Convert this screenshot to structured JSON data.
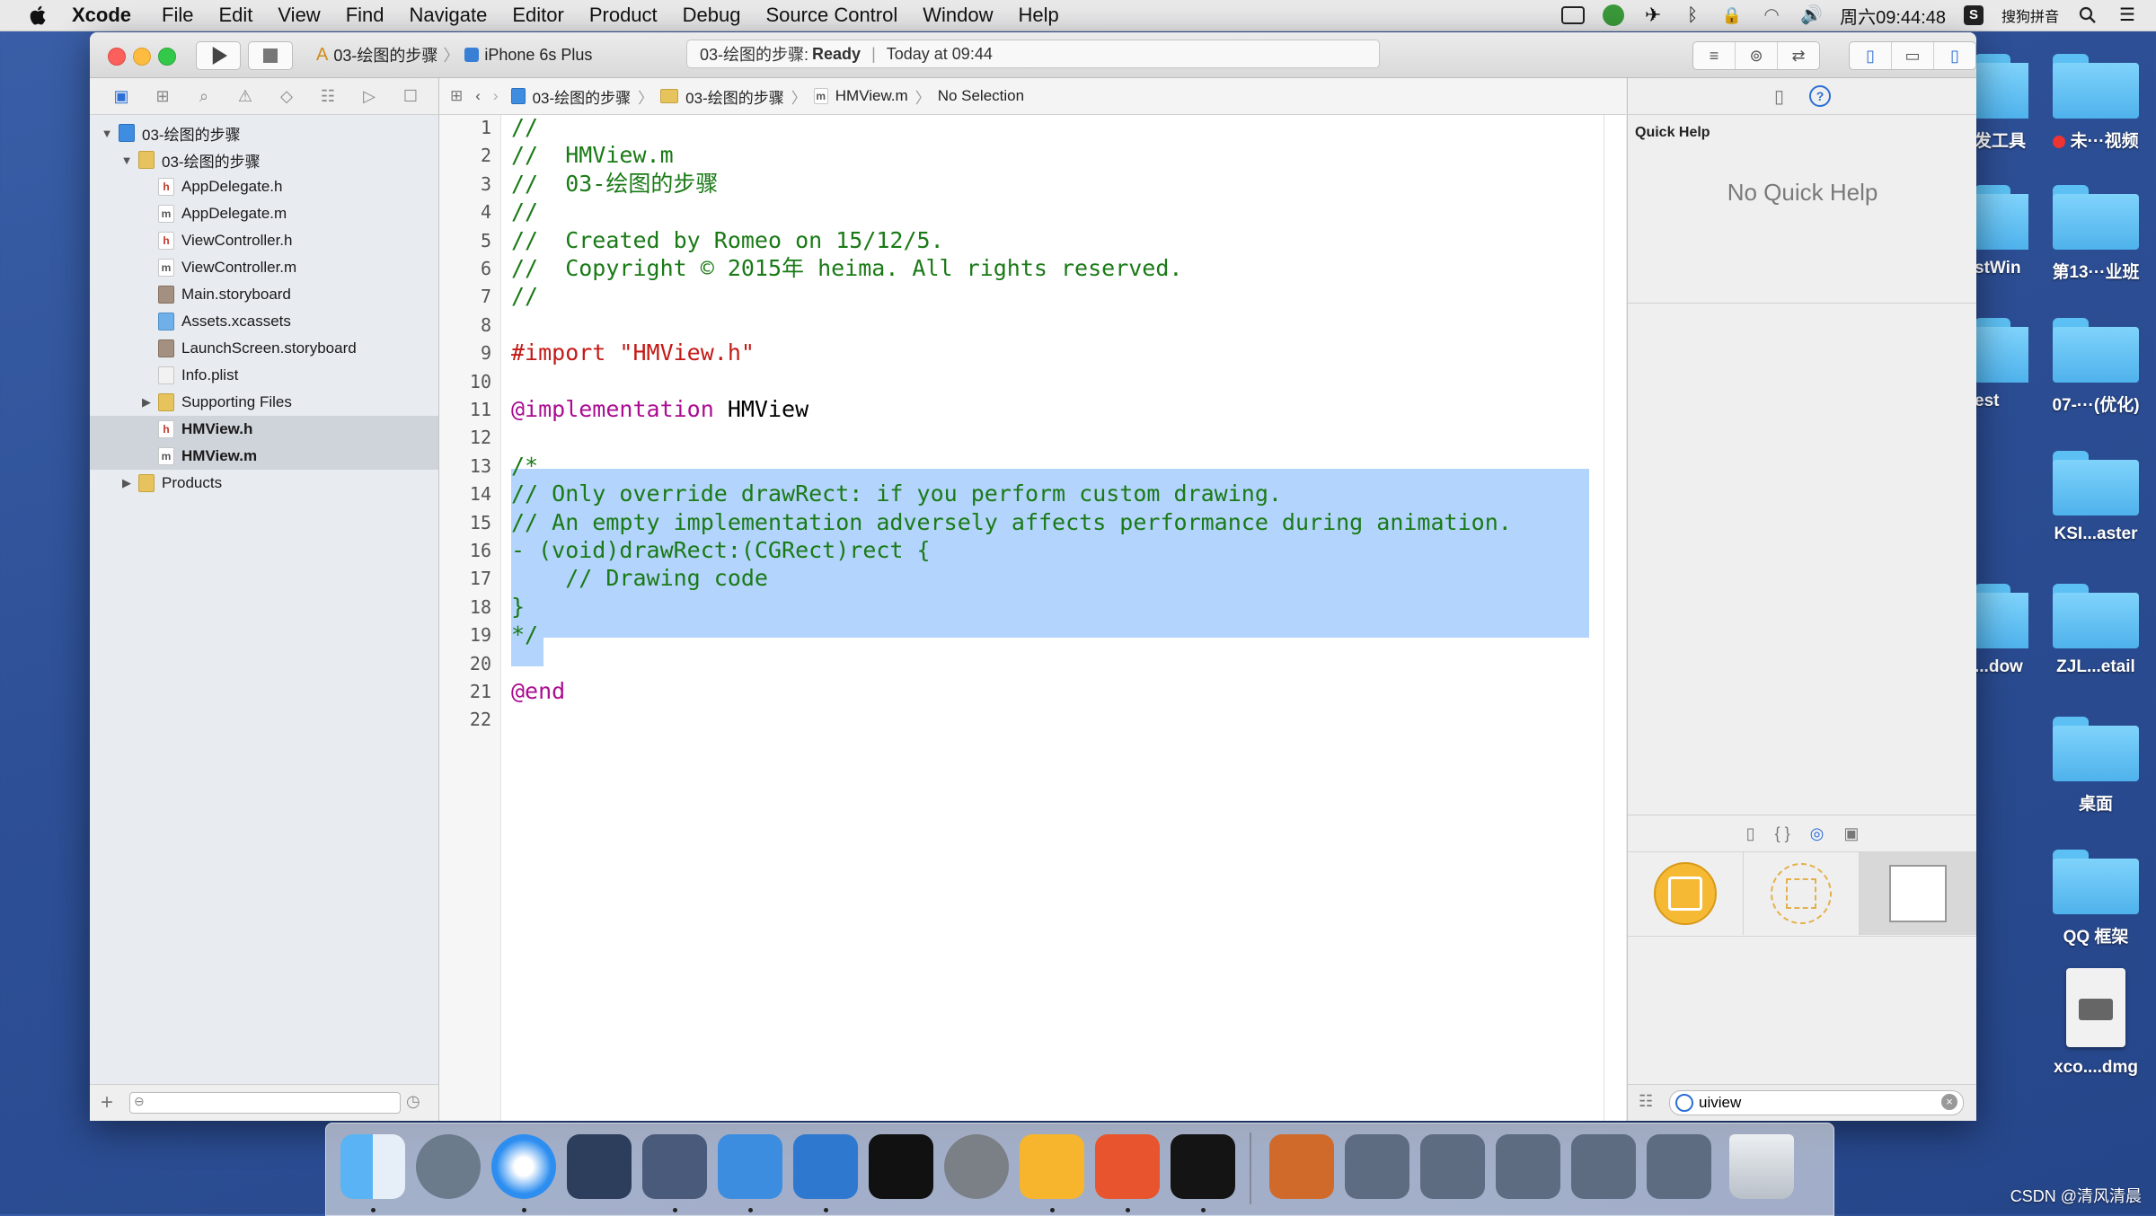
{
  "menubar": {
    "app": "Xcode",
    "items": [
      "File",
      "Edit",
      "View",
      "Find",
      "Navigate",
      "Editor",
      "Product",
      "Debug",
      "Source Control",
      "Window",
      "Help"
    ],
    "clock": "周六09:44:48",
    "input_method": "搜狗拼音"
  },
  "desktop": {
    "icons": [
      {
        "label": "未···视频"
      },
      {
        "label": "第13···业班"
      },
      {
        "label": "07-···(优化)"
      },
      {
        "label": "KSI...aster"
      },
      {
        "label": "ZJL...etail"
      },
      {
        "label": "桌面"
      },
      {
        "label": "QQ 框架"
      },
      {
        "label": "xco....dmg"
      }
    ],
    "partial_labels": [
      "发工具",
      "stWin",
      "est",
      "...dow"
    ]
  },
  "toolbar": {
    "scheme": "03-绘图的步骤",
    "device": "iPhone 6s Plus",
    "status_project": "03-绘图的步骤:",
    "status_state": "Ready",
    "status_sep": "|",
    "status_time": "Today at 09:44"
  },
  "jumpbar": {
    "crumbs": [
      "03-绘图的步骤",
      "03-绘图的步骤",
      "HMView.m",
      "No Selection"
    ]
  },
  "navigator": {
    "items": [
      {
        "label": "03-绘图的步骤",
        "kind": "proj",
        "indent": 0,
        "disclosure": "▼"
      },
      {
        "label": "03-绘图的步骤",
        "kind": "folder-s",
        "indent": 1,
        "disclosure": "▼"
      },
      {
        "label": "AppDelegate.h",
        "kind": "h",
        "indent": 2
      },
      {
        "label": "AppDelegate.m",
        "kind": "m",
        "indent": 2
      },
      {
        "label": "ViewController.h",
        "kind": "h",
        "indent": 2
      },
      {
        "label": "ViewController.m",
        "kind": "m",
        "indent": 2
      },
      {
        "label": "Main.storyboard",
        "kind": "sb",
        "indent": 2
      },
      {
        "label": "Assets.xcassets",
        "kind": "xc",
        "indent": 2
      },
      {
        "label": "LaunchScreen.storyboard",
        "kind": "sb",
        "indent": 2
      },
      {
        "label": "Info.plist",
        "kind": "pl",
        "indent": 2
      },
      {
        "label": "Supporting Files",
        "kind": "folder-s",
        "indent": 2,
        "disclosure": "▶"
      },
      {
        "label": "HMView.h",
        "kind": "h",
        "indent": 2,
        "selected": true
      },
      {
        "label": "HMView.m",
        "kind": "m",
        "indent": 2,
        "selected": true
      },
      {
        "label": "Products",
        "kind": "folder-s",
        "indent": 1,
        "disclosure": "▶"
      }
    ]
  },
  "editor": {
    "lines": [
      {
        "n": "1",
        "text": "//",
        "cls": "c-green"
      },
      {
        "n": "2",
        "text": "//  HMView.m",
        "cls": "c-green"
      },
      {
        "n": "3",
        "text": "//  03-绘图的步骤",
        "cls": "c-green"
      },
      {
        "n": "4",
        "text": "//",
        "cls": "c-green"
      },
      {
        "n": "5",
        "text": "//  Created by Romeo on 15/12/5.",
        "cls": "c-green"
      },
      {
        "n": "6",
        "text": "//  Copyright © 2015年 heima. All rights reserved.",
        "cls": "c-green"
      },
      {
        "n": "7",
        "text": "//",
        "cls": "c-green"
      },
      {
        "n": "8",
        "text": "",
        "cls": "c-black"
      },
      {
        "n": "9",
        "text": "#import \"HMView.h\"",
        "cls": "c-red"
      },
      {
        "n": "10",
        "text": "",
        "cls": "c-black"
      },
      {
        "n": "11",
        "text": "@implementation",
        "suffix": " HMView",
        "cls": "c-kw"
      },
      {
        "n": "12",
        "text": "",
        "cls": "c-black"
      },
      {
        "n": "13",
        "text": "/*",
        "cls": "c-green"
      },
      {
        "n": "14",
        "text": "// Only override drawRect: if you perform custom drawing.",
        "cls": "c-green"
      },
      {
        "n": "15",
        "text": "// An empty implementation adversely affects performance during animation.",
        "cls": "c-green"
      },
      {
        "n": "16",
        "text": "- (void)drawRect:(CGRect)rect {",
        "cls": "c-green"
      },
      {
        "n": "17",
        "text": "    // Drawing code",
        "cls": "c-green"
      },
      {
        "n": "18",
        "text": "}",
        "cls": "c-green"
      },
      {
        "n": "19",
        "text": "*/",
        "cls": "c-green"
      },
      {
        "n": "20",
        "text": "",
        "cls": "c-black"
      },
      {
        "n": "21",
        "text": "@end",
        "cls": "c-kw"
      },
      {
        "n": "22",
        "text": "",
        "cls": "c-black"
      }
    ]
  },
  "utilities": {
    "quick_help_title": "Quick Help",
    "quick_help_message": "No Quick Help",
    "filter_value": "uiview"
  },
  "watermark": "CSDN @清风清晨",
  "colors": {
    "selection": "#b3d4fc",
    "comment": "#1a7a16",
    "string": "#c41a16",
    "keyword": "#aa0d91"
  }
}
